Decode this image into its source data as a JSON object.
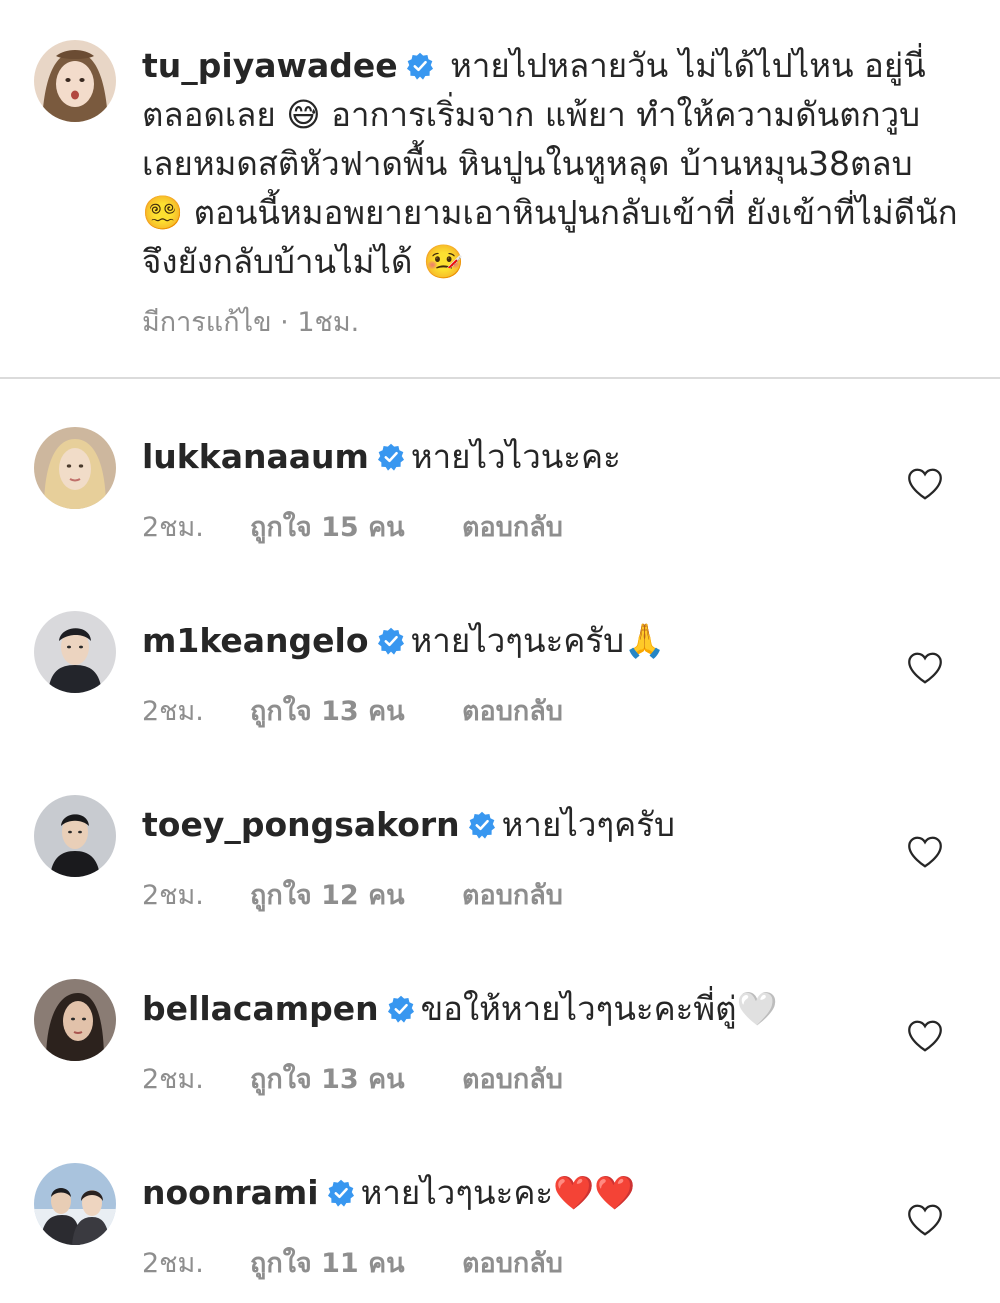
{
  "caption": {
    "username": "tu_piyawadee",
    "text_1": "หายไปหลายวัน ไม่ได้ไปไหน อยู่นี่ตลอดเลย",
    "emoji_1": "😅",
    "text_2": "อาการเริ่มจาก แพ้ยา ทำให้ความดันตกวูบ เลยหมดสติหัวฟาดพื้น หินปูนในหูหลุด บ้านหมุน38ตลบ",
    "emoji_2": "😵‍💫",
    "text_3": "ตอนนี้หมอพยายามเอาหินปูนกลับเข้าที่ ยังเข้าที่ไม่ดีนัก จึงยังกลับบ้านไม่ได้",
    "emoji_3": "🤒",
    "meta": "มีการแก้ไข · 1ชม."
  },
  "comments": [
    {
      "username": "lukkanaaum",
      "text": "หายไวไวนะคะ",
      "emoji": "",
      "time": "2ชม.",
      "likes": "ถูกใจ 15 คน",
      "reply": "ตอบกลับ"
    },
    {
      "username": "m1keangelo",
      "text": "หายไวๆนะครับ",
      "emoji": "🙏",
      "time": "2ชม.",
      "likes": "ถูกใจ 13 คน",
      "reply": "ตอบกลับ"
    },
    {
      "username": "toey_pongsakorn",
      "text": "หายไวๆครับ",
      "emoji": "",
      "time": "2ชม.",
      "likes": "ถูกใจ 12 คน",
      "reply": "ตอบกลับ"
    },
    {
      "username": "bellacampen",
      "text": "ขอให้หายไวๆนะคะพี่ตู่",
      "emoji": "🤍",
      "time": "2ชม.",
      "likes": "ถูกใจ 13 คน",
      "reply": "ตอบกลับ"
    },
    {
      "username": "noonrami",
      "text": "หายไวๆนะคะ",
      "emoji": "❤️❤️",
      "time": "2ชม.",
      "likes": "ถูกใจ 11 คน",
      "reply": "ตอบกลับ"
    }
  ],
  "icons": {
    "verified": "verified-badge-icon",
    "like": "heart-outline-icon"
  },
  "colors": {
    "verified_blue": "#3897f0",
    "meta_gray": "#8e8e8e",
    "text": "#262626",
    "divider": "#dbdbdb"
  }
}
